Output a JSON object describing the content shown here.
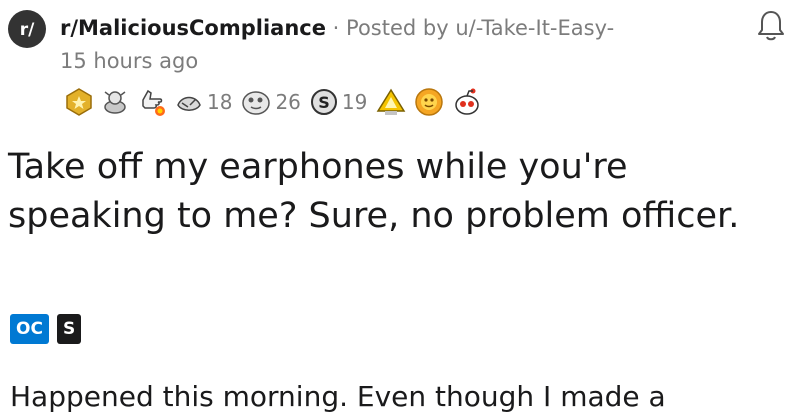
{
  "post": {
    "subreddit": "r/MaliciousCompliance",
    "subreddit_icon_text": "r/",
    "separator": "·",
    "posted_by": "Posted by u/-Take-It-Easy-",
    "time_ago": "15 hours ago",
    "title": "Take off my earphones while you're speaking to me? Sure, no problem officer.",
    "flairs": [
      {
        "label": "OC",
        "color": "#0079d3"
      },
      {
        "label": "S",
        "color": "#1a1a1b"
      }
    ],
    "body_preview": "Happened this morning. Even though I made a"
  },
  "awards": [
    {
      "icon": "gold-award-icon"
    },
    {
      "icon": "helpful-award-icon"
    },
    {
      "icon": "wholesome-award-icon"
    },
    {
      "icon": "hugz-award-icon",
      "count": "18"
    },
    {
      "icon": "silver-award-icon",
      "count": "26"
    },
    {
      "icon": "dollar-award-icon",
      "count": "19"
    },
    {
      "icon": "take-my-energy-award-icon"
    },
    {
      "icon": "starstruck-award-icon"
    },
    {
      "icon": "snoo-award-icon"
    }
  ],
  "colors": {
    "meta_text": "#7c7c7c",
    "oc_flair": "#0079d3",
    "spoiler_flair": "#1a1a1b",
    "subreddit_icon_bg": "#333333"
  }
}
